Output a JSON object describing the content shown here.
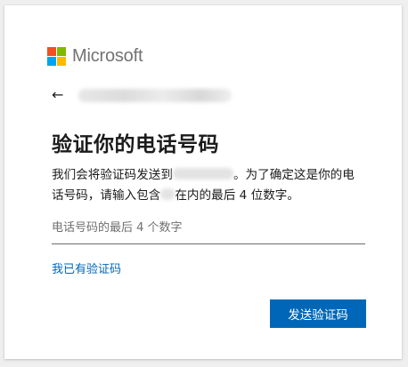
{
  "brand": {
    "name": "Microsoft",
    "colors": [
      "#f25022",
      "#7fba00",
      "#00a4ef",
      "#ffb900"
    ]
  },
  "nav": {
    "back_icon": "back-arrow-icon"
  },
  "main": {
    "title": "验证你的电话号码",
    "description": {
      "part1": "我们会将验证码发送到",
      "part2": "。为了确定这是你的电话号码，请输入包含",
      "part3": "在内的最后 4 位数字。"
    },
    "phone_input": {
      "placeholder": "电话号码的最后 4 个数字",
      "value": ""
    },
    "have_code_link": "我已有验证码",
    "send_button": "发送验证码"
  },
  "theme": {
    "accent": "#0067b8"
  }
}
